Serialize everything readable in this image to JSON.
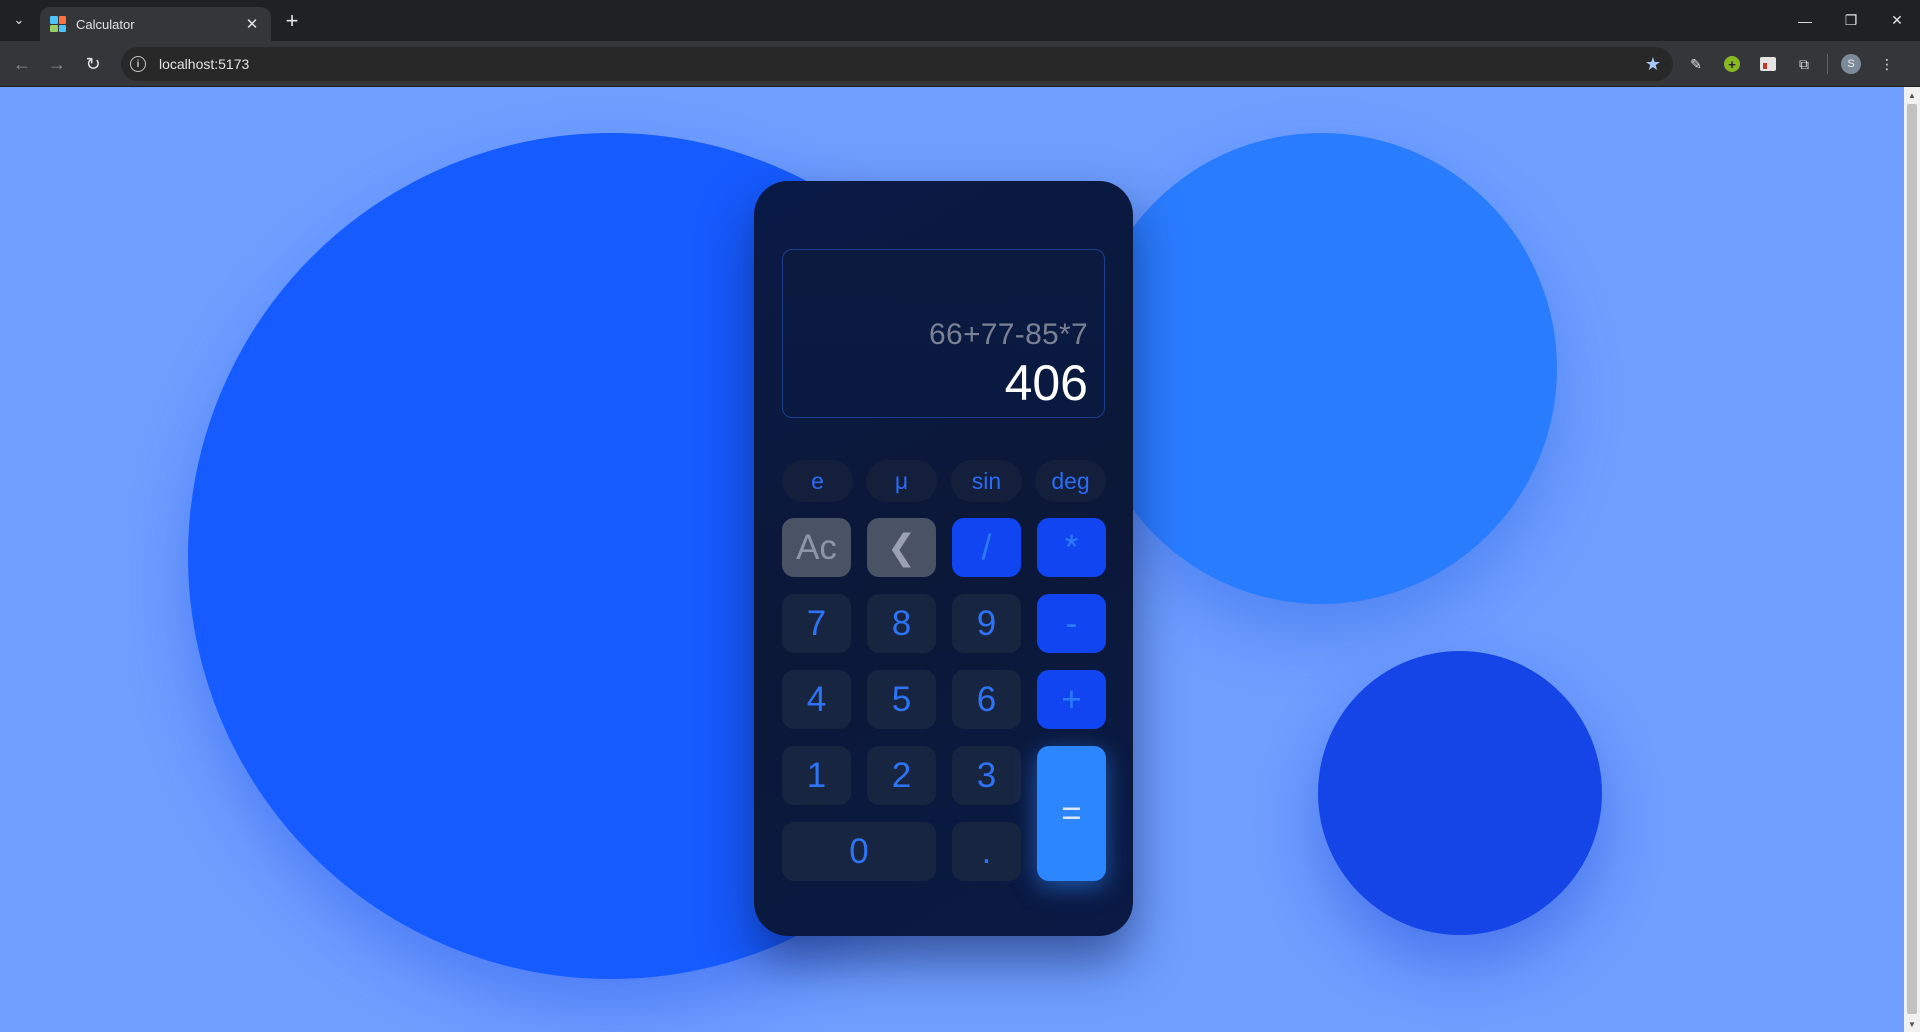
{
  "browser": {
    "tab_title": "Calculator",
    "url": "localhost:5173",
    "avatar_letter": "S"
  },
  "calculator": {
    "expression": "66+77-85*7",
    "result": "406",
    "scientific": [
      "e",
      "μ",
      "sin",
      "deg"
    ],
    "keys": {
      "clear": "Ac",
      "backspace": "❮",
      "divide": "/",
      "multiply": "*",
      "seven": "7",
      "eight": "8",
      "nine": "9",
      "minus": "-",
      "four": "4",
      "five": "5",
      "six": "6",
      "plus": "+",
      "one": "1",
      "two": "2",
      "three": "3",
      "equals": "=",
      "zero": "0",
      "decimal": "."
    }
  },
  "colors": {
    "page_background": "#6f9eff",
    "calculator_body": "#0b1838",
    "operator_key": "#1245f2",
    "equals_key": "#2c86ff",
    "accent_text": "#2e73f5"
  }
}
